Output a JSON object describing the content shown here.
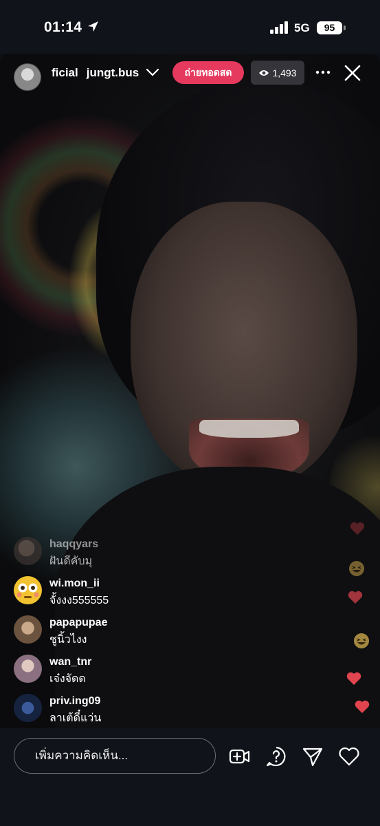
{
  "status_bar": {
    "time": "01:14",
    "network": "5G",
    "battery": "95"
  },
  "live": {
    "host_names": [
      "ficial",
      "jungt.bus"
    ],
    "live_badge": "ถ่ายทอดสด",
    "viewer_count": "1,493"
  },
  "comments": [
    {
      "username": "haqqyars",
      "text": "ฝันดีคับมุ"
    },
    {
      "username": "wi.mon_ii",
      "text": "จั้งงง555555"
    },
    {
      "username": "papapupae",
      "text": "ชูนิ้วไงง"
    },
    {
      "username": "wan_tnr",
      "text": "เจ๋งจัดด"
    },
    {
      "username": "priv.ing09",
      "text": "ลาเต้ดี๋แว่น"
    }
  ],
  "input": {
    "placeholder": "เพิ่มความคิดเห็น..."
  },
  "icons": {
    "location": "location-arrow-icon",
    "viewers": "eye-icon",
    "more": "more-horizontal-icon",
    "close": "close-icon",
    "add_video": "add-video-icon",
    "question": "question-icon",
    "share": "send-icon",
    "like": "heart-icon"
  },
  "colors": {
    "live_badge": "#e6395e",
    "heart": "#e0454f",
    "background": "#101319"
  }
}
